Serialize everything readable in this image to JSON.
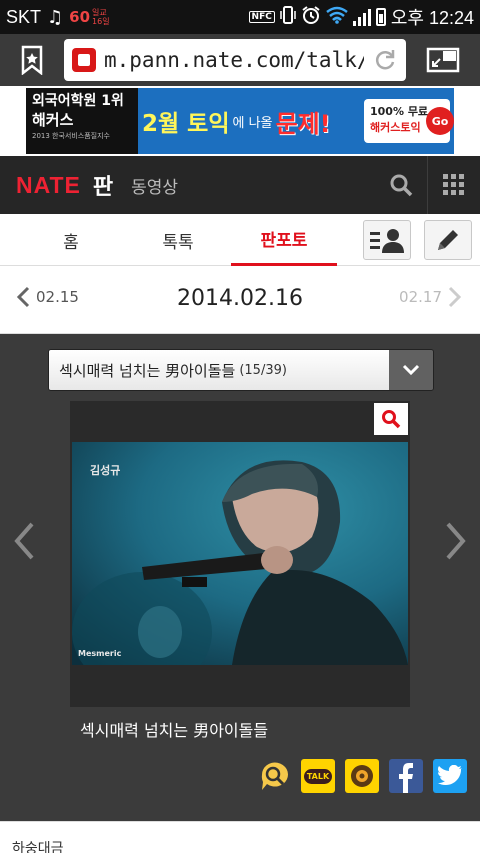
{
  "status_bar": {
    "carrier": "SKT",
    "temperature": "60",
    "weather_line1": "일교",
    "weather_line2": "16일",
    "time": "오후 12:24",
    "nfc": "NFC",
    "icons": [
      "music-note-icon",
      "nfc-icon",
      "vibrate-icon",
      "alarm-icon",
      "wifi-icon",
      "signal-icon",
      "battery-icon"
    ]
  },
  "browser": {
    "url": "m.pann.nate.com/talk/p",
    "icons": [
      "bookmark-icon",
      "reload-icon",
      "tabs-icon"
    ]
  },
  "ad": {
    "brand_line1": "외국어학원 1위",
    "brand_line2": "해커스",
    "brand_line3": "2013 한국서비스품질지수",
    "headline_a": "2월 토익",
    "headline_b": "에 나올",
    "headline_c": "문제!",
    "badge_line1": "100% 무료",
    "badge_line2": "해커스토익",
    "go": "Go"
  },
  "header": {
    "logo": "NATE",
    "section": "판",
    "subsection": "동영상"
  },
  "tabs": [
    {
      "label": "홈"
    },
    {
      "label": "톡톡"
    },
    {
      "label": "판포토"
    }
  ],
  "date_nav": {
    "prev": "02.15",
    "current": "2014.02.16",
    "next": "02.17"
  },
  "gallery": {
    "dropdown_title": "섹시매력 넘치는 男아이돌들",
    "dropdown_count": "(15/39)",
    "photo_name_tag": "김성규",
    "photo_watermark": "Mesmeric",
    "caption": "섹시매력 넘치는 男아이돌들"
  },
  "share": {
    "kakaotalk": "TALK"
  },
  "footer": {
    "text": "하숭대금"
  },
  "colors": {
    "accent": "#e0101c",
    "header_bg": "#262626",
    "content_bg": "#3b3b3b",
    "facebook": "#3b5998",
    "twitter": "#1da1f2",
    "kakao": "#ffd400"
  }
}
